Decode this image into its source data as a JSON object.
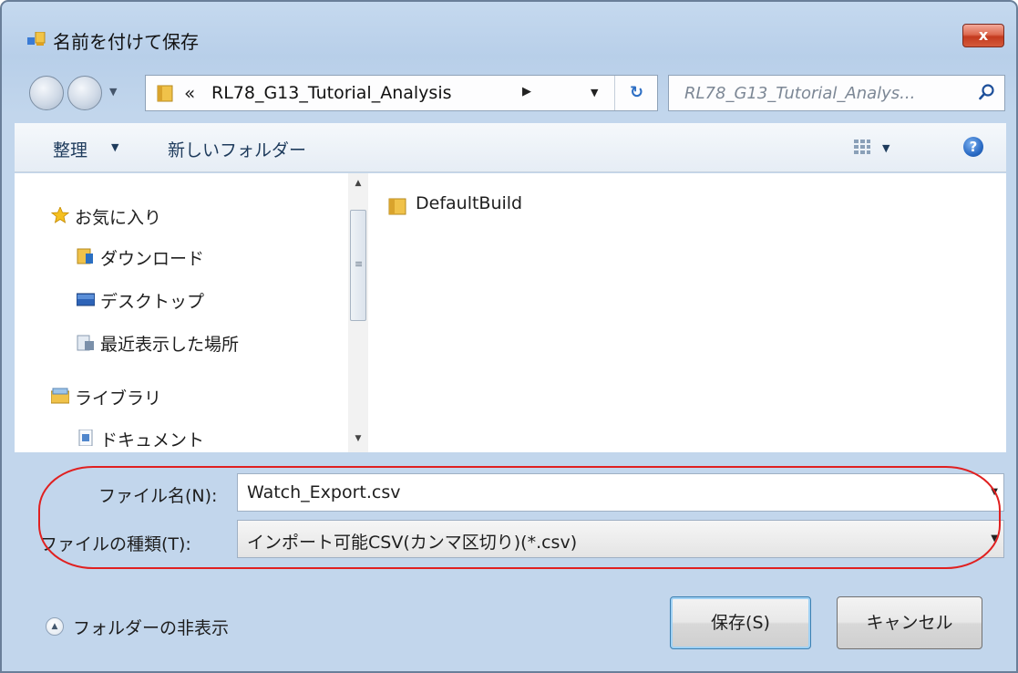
{
  "window": {
    "title": "名前を付けて保存",
    "close_label": "x"
  },
  "address": {
    "chevron": "«",
    "path": "RL78_G13_Tutorial_Analysis",
    "separator": "▶"
  },
  "search": {
    "placeholder": "RL78_G13_Tutorial_Analys..."
  },
  "toolbar": {
    "organize_label": "整理",
    "new_folder_label": "新しいフォルダー",
    "help_label": "?"
  },
  "nav_pane": {
    "favorites": "お気に入り",
    "downloads": "ダウンロード",
    "desktop": "デスクトップ",
    "recent": "最近表示した場所",
    "libraries": "ライブラリ",
    "documents": "ドキュメント"
  },
  "files": [
    {
      "name": "DefaultBuild",
      "type": "folder"
    }
  ],
  "form": {
    "file_name_label": "ファイル名(N):",
    "file_name_value": "Watch_Export.csv",
    "file_type_label": "ファイルの種類(T):",
    "file_type_value": "インポート可能CSV(カンマ区切り)(*.csv)"
  },
  "footer": {
    "hide_folders_label": "フォルダーの非表示",
    "save_label": "保存(S)",
    "cancel_label": "キャンセル"
  },
  "colors": {
    "highlight": "#e02020",
    "close_button": "#c33a1f",
    "window_frame": "#b8cfe9"
  }
}
